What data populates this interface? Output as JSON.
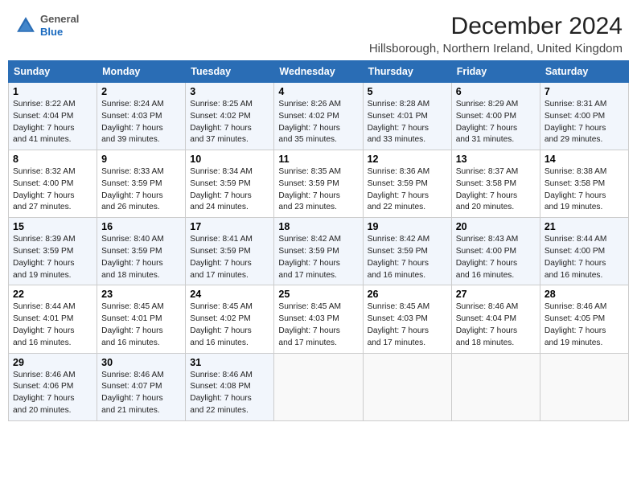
{
  "header": {
    "logo_general": "General",
    "logo_blue": "Blue",
    "main_title": "December 2024",
    "subtitle": "Hillsborough, Northern Ireland, United Kingdom"
  },
  "calendar": {
    "days_of_week": [
      "Sunday",
      "Monday",
      "Tuesday",
      "Wednesday",
      "Thursday",
      "Friday",
      "Saturday"
    ],
    "weeks": [
      [
        {
          "day": "",
          "detail": ""
        },
        {
          "day": "2",
          "detail": "Sunrise: 8:24 AM\nSunset: 4:03 PM\nDaylight: 7 hours\nand 39 minutes."
        },
        {
          "day": "3",
          "detail": "Sunrise: 8:25 AM\nSunset: 4:02 PM\nDaylight: 7 hours\nand 37 minutes."
        },
        {
          "day": "4",
          "detail": "Sunrise: 8:26 AM\nSunset: 4:02 PM\nDaylight: 7 hours\nand 35 minutes."
        },
        {
          "day": "5",
          "detail": "Sunrise: 8:28 AM\nSunset: 4:01 PM\nDaylight: 7 hours\nand 33 minutes."
        },
        {
          "day": "6",
          "detail": "Sunrise: 8:29 AM\nSunset: 4:00 PM\nDaylight: 7 hours\nand 31 minutes."
        },
        {
          "day": "7",
          "detail": "Sunrise: 8:31 AM\nSunset: 4:00 PM\nDaylight: 7 hours\nand 29 minutes."
        }
      ],
      [
        {
          "day": "1",
          "detail": "Sunrise: 8:22 AM\nSunset: 4:04 PM\nDaylight: 7 hours\nand 41 minutes."
        },
        {
          "day": "",
          "detail": ""
        },
        {
          "day": "",
          "detail": ""
        },
        {
          "day": "",
          "detail": ""
        },
        {
          "day": "",
          "detail": ""
        },
        {
          "day": "",
          "detail": ""
        },
        {
          "day": "",
          "detail": ""
        }
      ],
      [
        {
          "day": "8",
          "detail": "Sunrise: 8:32 AM\nSunset: 4:00 PM\nDaylight: 7 hours\nand 27 minutes."
        },
        {
          "day": "9",
          "detail": "Sunrise: 8:33 AM\nSunset: 3:59 PM\nDaylight: 7 hours\nand 26 minutes."
        },
        {
          "day": "10",
          "detail": "Sunrise: 8:34 AM\nSunset: 3:59 PM\nDaylight: 7 hours\nand 24 minutes."
        },
        {
          "day": "11",
          "detail": "Sunrise: 8:35 AM\nSunset: 3:59 PM\nDaylight: 7 hours\nand 23 minutes."
        },
        {
          "day": "12",
          "detail": "Sunrise: 8:36 AM\nSunset: 3:59 PM\nDaylight: 7 hours\nand 22 minutes."
        },
        {
          "day": "13",
          "detail": "Sunrise: 8:37 AM\nSunset: 3:58 PM\nDaylight: 7 hours\nand 20 minutes."
        },
        {
          "day": "14",
          "detail": "Sunrise: 8:38 AM\nSunset: 3:58 PM\nDaylight: 7 hours\nand 19 minutes."
        }
      ],
      [
        {
          "day": "15",
          "detail": "Sunrise: 8:39 AM\nSunset: 3:59 PM\nDaylight: 7 hours\nand 19 minutes."
        },
        {
          "day": "16",
          "detail": "Sunrise: 8:40 AM\nSunset: 3:59 PM\nDaylight: 7 hours\nand 18 minutes."
        },
        {
          "day": "17",
          "detail": "Sunrise: 8:41 AM\nSunset: 3:59 PM\nDaylight: 7 hours\nand 17 minutes."
        },
        {
          "day": "18",
          "detail": "Sunrise: 8:42 AM\nSunset: 3:59 PM\nDaylight: 7 hours\nand 17 minutes."
        },
        {
          "day": "19",
          "detail": "Sunrise: 8:42 AM\nSunset: 3:59 PM\nDaylight: 7 hours\nand 16 minutes."
        },
        {
          "day": "20",
          "detail": "Sunrise: 8:43 AM\nSunset: 4:00 PM\nDaylight: 7 hours\nand 16 minutes."
        },
        {
          "day": "21",
          "detail": "Sunrise: 8:44 AM\nSunset: 4:00 PM\nDaylight: 7 hours\nand 16 minutes."
        }
      ],
      [
        {
          "day": "22",
          "detail": "Sunrise: 8:44 AM\nSunset: 4:01 PM\nDaylight: 7 hours\nand 16 minutes."
        },
        {
          "day": "23",
          "detail": "Sunrise: 8:45 AM\nSunset: 4:01 PM\nDaylight: 7 hours\nand 16 minutes."
        },
        {
          "day": "24",
          "detail": "Sunrise: 8:45 AM\nSunset: 4:02 PM\nDaylight: 7 hours\nand 16 minutes."
        },
        {
          "day": "25",
          "detail": "Sunrise: 8:45 AM\nSunset: 4:03 PM\nDaylight: 7 hours\nand 17 minutes."
        },
        {
          "day": "26",
          "detail": "Sunrise: 8:45 AM\nSunset: 4:03 PM\nDaylight: 7 hours\nand 17 minutes."
        },
        {
          "day": "27",
          "detail": "Sunrise: 8:46 AM\nSunset: 4:04 PM\nDaylight: 7 hours\nand 18 minutes."
        },
        {
          "day": "28",
          "detail": "Sunrise: 8:46 AM\nSunset: 4:05 PM\nDaylight: 7 hours\nand 19 minutes."
        }
      ],
      [
        {
          "day": "29",
          "detail": "Sunrise: 8:46 AM\nSunset: 4:06 PM\nDaylight: 7 hours\nand 20 minutes."
        },
        {
          "day": "30",
          "detail": "Sunrise: 8:46 AM\nSunset: 4:07 PM\nDaylight: 7 hours\nand 21 minutes."
        },
        {
          "day": "31",
          "detail": "Sunrise: 8:46 AM\nSunset: 4:08 PM\nDaylight: 7 hours\nand 22 minutes."
        },
        {
          "day": "",
          "detail": ""
        },
        {
          "day": "",
          "detail": ""
        },
        {
          "day": "",
          "detail": ""
        },
        {
          "day": "",
          "detail": ""
        }
      ]
    ]
  }
}
